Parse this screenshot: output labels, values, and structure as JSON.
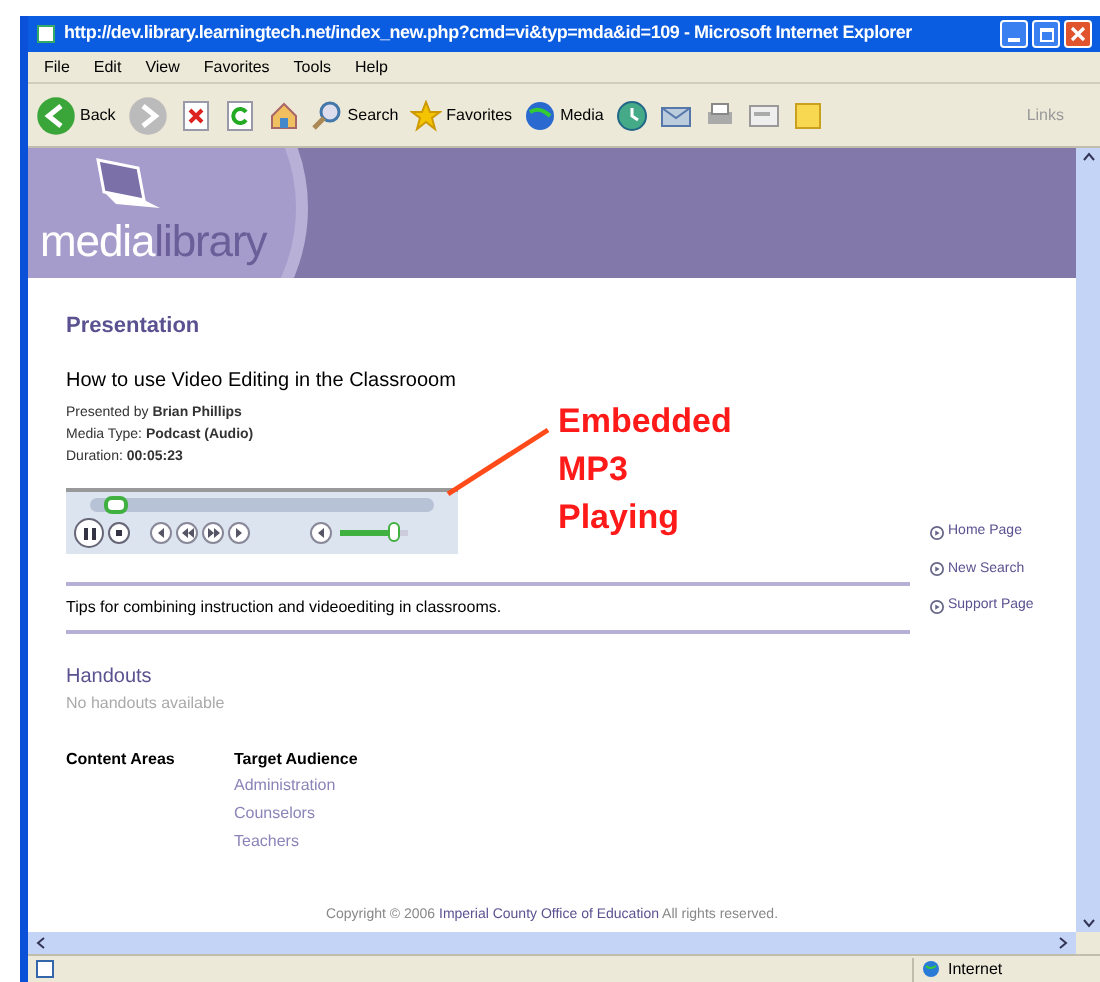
{
  "window": {
    "title": "http://dev.library.learningtech.net/index_new.php?cmd=vi&typ=mda&id=109 - Microsoft Internet Explorer"
  },
  "menu": [
    "File",
    "Edit",
    "View",
    "Favorites",
    "Tools",
    "Help"
  ],
  "toolbar": [
    {
      "kind": "back",
      "label": "Back"
    },
    {
      "kind": "forward"
    },
    {
      "kind": "stop"
    },
    {
      "kind": "refresh"
    },
    {
      "kind": "home"
    },
    {
      "kind": "search",
      "label": "Search"
    },
    {
      "kind": "favorites",
      "label": "Favorites"
    },
    {
      "kind": "media",
      "label": "Media"
    },
    {
      "kind": "history"
    },
    {
      "kind": "mail"
    },
    {
      "kind": "print"
    },
    {
      "kind": "edit"
    },
    {
      "kind": "note"
    }
  ],
  "links_label": "Links",
  "page": {
    "logo": {
      "light": "media",
      "dark": "library"
    },
    "section_title": "Presentation",
    "title": "How to use Video Editing in the Classrooom",
    "details": [
      "Presented by **Brian Phillips**",
      "Media Type: **Podcast (Audio)**",
      "Duration: **00:05:23**"
    ],
    "player": {
      "seek": {
        "level": 0.05
      },
      "volume": {
        "level": 0.8
      }
    },
    "annotation": [
      "Embedded",
      "MP3",
      "Playing"
    ],
    "side_links": [
      "Home Page",
      "New Search",
      "Support Page"
    ],
    "description": "Tips for combining instruction and videoediting in classrooms.",
    "handouts": {
      "heading": "Handouts",
      "note": "No handouts available"
    },
    "content_areas": {
      "heading": "Content Areas"
    },
    "target_audience": {
      "heading": "Target Audience",
      "items": [
        "Administration",
        "Counselors",
        "Teachers"
      ]
    },
    "footer": {
      "before": "Copyright © 2006",
      "link": "Imperial County Office of Education",
      "after": "All rights reserved."
    }
  },
  "status_bar": {
    "zone": "Internet"
  }
}
